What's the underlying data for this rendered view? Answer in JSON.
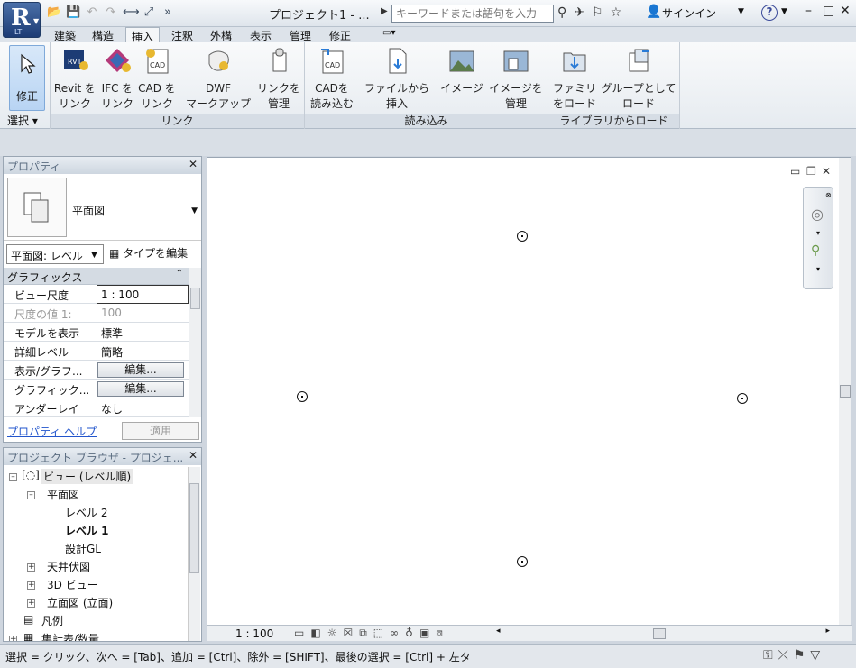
{
  "app": {
    "name_letter": "R",
    "edition": "LT"
  },
  "title": {
    "text": "プロジェクト1 - ...",
    "search_placeholder": "キーワードまたは語句を入力",
    "signin": "サインイン",
    "help": "?"
  },
  "tabs": [
    "建築",
    "構造",
    "挿入",
    "注釈",
    "外構",
    "表示",
    "管理",
    "修正"
  ],
  "active_tab": "挿入",
  "ribbon": {
    "select": {
      "label": "修正",
      "panel_label": "選択 ▾"
    },
    "link_panel": {
      "label": "リンク",
      "buttons": [
        {
          "line1": "Revit を",
          "line2": "リンク"
        },
        {
          "line1": "IFC を",
          "line2": "リンク"
        },
        {
          "line1": "CAD を",
          "line2": "リンク"
        },
        {
          "line1": "DWF",
          "line2": "マークアップ"
        },
        {
          "line1": "リンクを",
          "line2": "管理"
        }
      ]
    },
    "import_panel": {
      "label": "読み込み",
      "buttons": [
        {
          "line1": "CADを",
          "line2": "読み込む"
        },
        {
          "line1": "ファイルから",
          "line2": "挿入"
        },
        {
          "line1": "イメージ",
          "line2": ""
        },
        {
          "line1": "イメージを",
          "line2": "管理"
        }
      ]
    },
    "library_panel": {
      "label": "ライブラリからロード",
      "buttons": [
        {
          "line1": "ファミリ",
          "line2": "をロード"
        },
        {
          "line1": "グループとして",
          "line2": "ロード"
        }
      ]
    }
  },
  "properties": {
    "title": "プロパティ",
    "type_name": "平面図",
    "view_select": "平面図: レベル",
    "edit_type": "タイプを編集",
    "group_header": "グラフィックス",
    "rows": [
      {
        "key": "ビュー尺度",
        "value": "1 : 100"
      },
      {
        "key": "尺度の値    1:",
        "value": "100"
      },
      {
        "key": "モデルを表示",
        "value": "標準"
      },
      {
        "key": "詳細レベル",
        "value": "簡略"
      },
      {
        "key": "表示/グラフ...",
        "value": "編集..."
      },
      {
        "key": "グラフィック...",
        "value": "編集..."
      },
      {
        "key": "アンダーレイ",
        "value": "なし"
      }
    ],
    "help_link": "プロパティ ヘルプ",
    "apply": "適用"
  },
  "browser": {
    "title": "プロジェクト ブラウザ - プロジェ...",
    "items": [
      {
        "label": "ビュー (レベル順)"
      },
      {
        "label": "平面図"
      },
      {
        "label": "レベル 2"
      },
      {
        "label": "レベル 1"
      },
      {
        "label": "設計GL"
      },
      {
        "label": "天井伏図"
      },
      {
        "label": "3D ビュー"
      },
      {
        "label": "立面図 (立面)"
      },
      {
        "label": "凡例"
      },
      {
        "label": "集計表/数量"
      }
    ]
  },
  "view": {
    "scale": "1 : 100"
  },
  "status": {
    "text": "選択 = クリック、次へ = [Tab]、追加 = [Ctrl]、除外 = [SHIFT]、最後の選択 = [Ctrl] + 左タ"
  },
  "colors": {
    "accent": "#1d3c75",
    "link": "#2255cc",
    "ribbon_bg": "#f9fafb"
  }
}
